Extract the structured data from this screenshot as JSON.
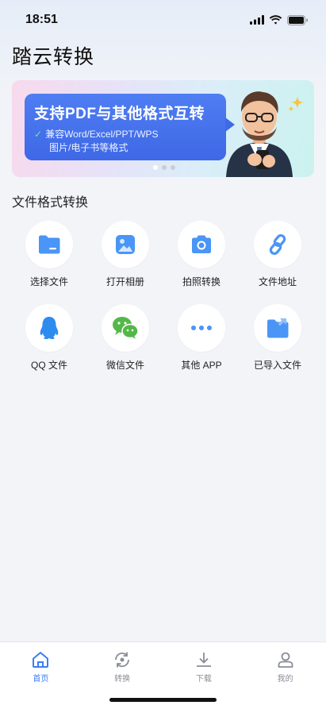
{
  "status_bar": {
    "time": "18:51",
    "icons": [
      "cellular-signal-icon",
      "wifi-icon",
      "battery-icon"
    ]
  },
  "page_title": "踏云转换",
  "banner": {
    "headline": "支持PDF与其他格式互转",
    "subtitle_line1": "兼容Word/Excel/PPT/WPS",
    "subtitle_line2": "图片/电子书等格式",
    "check_mark": "✓",
    "page_count": 3,
    "active_page": 1
  },
  "section_title": "文件格式转换",
  "grid": {
    "items": [
      {
        "label": "选择文件",
        "icon": "folder-icon"
      },
      {
        "label": "打开相册",
        "icon": "photo-album-icon"
      },
      {
        "label": "拍照转换",
        "icon": "camera-icon"
      },
      {
        "label": "文件地址",
        "icon": "link-icon"
      },
      {
        "label": "QQ 文件",
        "icon": "qq-icon"
      },
      {
        "label": "微信文件",
        "icon": "wechat-icon"
      },
      {
        "label": "其他 APP",
        "icon": "more-dots-icon"
      },
      {
        "label": "已导入文件",
        "icon": "imported-folder-icon"
      }
    ]
  },
  "tab_bar": {
    "tabs": [
      {
        "label": "首页",
        "icon": "home-icon",
        "active": true
      },
      {
        "label": "转换",
        "icon": "convert-icon",
        "active": false
      },
      {
        "label": "下载",
        "icon": "download-icon",
        "active": false
      },
      {
        "label": "我的",
        "icon": "user-icon",
        "active": false
      }
    ]
  },
  "colors": {
    "accent": "#3b7cf5",
    "icon_blue": "#4a95f5",
    "wechat_green": "#53b848",
    "qq_blue": "#2d8cf0",
    "tab_inactive": "#8a8d96",
    "banner_bubble": "#4f7df2"
  }
}
